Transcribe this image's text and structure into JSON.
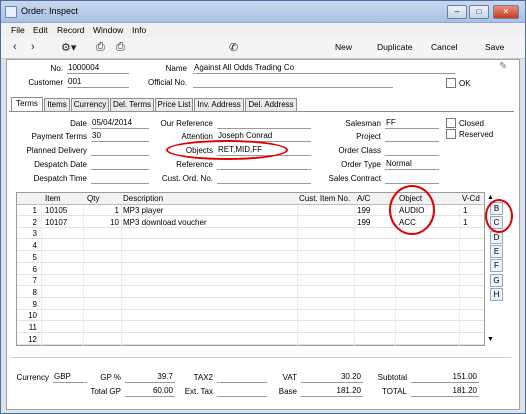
{
  "window": {
    "title": "Order: Inspect"
  },
  "menu": [
    "File",
    "Edit",
    "Record",
    "Window",
    "Info"
  ],
  "toolbar": {
    "new": "New",
    "duplicate": "Duplicate",
    "cancel": "Cancel",
    "save": "Save"
  },
  "header": {
    "no_label": "No.",
    "no": "1000004",
    "name_label": "Name",
    "name": "Against All Odds Trading Co",
    "customer_label": "Customer",
    "customer": "001",
    "official_label": "Official No.",
    "official": "",
    "ok_label": "OK"
  },
  "tabs": [
    "Terms",
    "Items",
    "Currency",
    "Del. Terms",
    "Price List",
    "Inv. Address",
    "Del. Address"
  ],
  "terms": {
    "date_label": "Date",
    "date": "05/04/2014",
    "payterms_label": "Payment Terms",
    "payterms": "30",
    "planned_label": "Planned Delivery",
    "planned": "",
    "despdate_label": "Despatch Date",
    "despdate": "",
    "desptime_label": "Despatch Time",
    "desptime": "",
    "ourref_label": "Our Reference",
    "ourref": "",
    "attention_label": "Attention",
    "attention": "Joseph Conrad",
    "objects_label": "Objects",
    "objects": "RET,MID,FF",
    "reference_label": "Reference",
    "reference": "",
    "custord_label": "Cust. Ord. No.",
    "custord": "",
    "salesman_label": "Salesman",
    "salesman": "FF",
    "project_label": "Project",
    "project": "",
    "orderclass_label": "Order Class",
    "orderclass": "",
    "ordertype_label": "Order Type",
    "ordertype": "Normal",
    "salescontract_label": "Sales Contract",
    "salescontract": "",
    "closed_label": "Closed",
    "reserved_label": "Reserved"
  },
  "grid": {
    "headers": {
      "item": "Item",
      "qty": "Qty",
      "description": "Description",
      "custitem": "Cust. Item No.",
      "ac": "A/C",
      "object": "Object",
      "vcd": "V-Cd"
    },
    "rows": [
      {
        "n": "1",
        "item": "10105",
        "qty": "1",
        "description": "MP3 player",
        "ac": "199",
        "object": "AUDIO",
        "vcd": "1"
      },
      {
        "n": "2",
        "item": "10107",
        "qty": "10",
        "description": "MP3 download voucher",
        "ac": "199",
        "object": "ACC",
        "vcd": "1"
      },
      {
        "n": "3"
      },
      {
        "n": "4"
      },
      {
        "n": "5"
      },
      {
        "n": "6"
      },
      {
        "n": "7"
      },
      {
        "n": "8"
      },
      {
        "n": "9"
      },
      {
        "n": "10"
      },
      {
        "n": "11"
      },
      {
        "n": "12"
      }
    ],
    "letters": [
      "B",
      "C",
      "D",
      "E",
      "F",
      "G",
      "H"
    ]
  },
  "footer": {
    "currency_label": "Currency",
    "currency": "GBP",
    "gp_label": "GP %",
    "gp": "39.7",
    "totalgp_label": "Total GP",
    "totalgp": "60.00",
    "tax2_label": "TAX2",
    "tax2": "",
    "exttax_label": "Ext. Tax",
    "exttax": "",
    "vat_label": "VAT",
    "vat": "30.20",
    "base_label": "Base",
    "base": "181.20",
    "subtotal_label": "Subtotal",
    "subtotal": "151.00",
    "total_label": "TOTAL",
    "total": "181.20"
  }
}
